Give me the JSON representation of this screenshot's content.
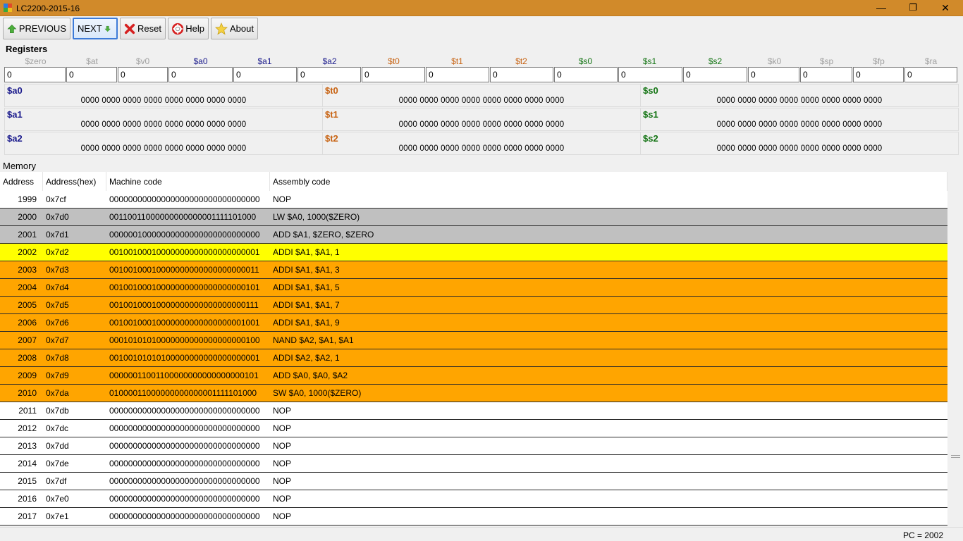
{
  "window": {
    "title": "LC2200-2015-16",
    "minimize": "—",
    "restore": "❐",
    "close": "✕"
  },
  "toolbar": {
    "previous_label": "PREVIOUS",
    "next_label": "NEXT",
    "reset_label": "Reset",
    "help_label": "Help",
    "about_label": "About"
  },
  "registers": {
    "title": "Registers",
    "names": [
      {
        "name": "$zero",
        "color": "#a0a0a0"
      },
      {
        "name": "$at",
        "color": "#a0a0a0"
      },
      {
        "name": "$v0",
        "color": "#a0a0a0"
      },
      {
        "name": "$a0",
        "color": "#1a1a8c"
      },
      {
        "name": "$a1",
        "color": "#1a1a8c"
      },
      {
        "name": "$a2",
        "color": "#1a1a8c"
      },
      {
        "name": "$t0",
        "color": "#c86414"
      },
      {
        "name": "$t1",
        "color": "#c86414"
      },
      {
        "name": "$t2",
        "color": "#c86414"
      },
      {
        "name": "$s0",
        "color": "#127312"
      },
      {
        "name": "$s1",
        "color": "#127312"
      },
      {
        "name": "$s2",
        "color": "#127312"
      },
      {
        "name": "$k0",
        "color": "#a0a0a0"
      },
      {
        "name": "$sp",
        "color": "#a0a0a0"
      },
      {
        "name": "$fp",
        "color": "#a0a0a0"
      },
      {
        "name": "$ra",
        "color": "#a0a0a0"
      }
    ],
    "values": [
      "0",
      "0",
      "0",
      "0",
      "0",
      "0",
      "0",
      "0",
      "0",
      "0",
      "0",
      "0",
      "0",
      "0",
      "0",
      "0"
    ],
    "binary": [
      {
        "name": "$a0",
        "value": "0000 0000 0000 0000 0000 0000 0000 0000",
        "color": "#1a1a8c"
      },
      {
        "name": "$t0",
        "value": "0000 0000 0000 0000 0000 0000 0000 0000",
        "color": "#c86414"
      },
      {
        "name": "$s0",
        "value": "0000 0000 0000 0000 0000 0000 0000 0000",
        "color": "#127312"
      },
      {
        "name": "$a1",
        "value": "0000 0000 0000 0000 0000 0000 0000 0000",
        "color": "#1a1a8c"
      },
      {
        "name": "$t1",
        "value": "0000 0000 0000 0000 0000 0000 0000 0000",
        "color": "#c86414"
      },
      {
        "name": "$s1",
        "value": "0000 0000 0000 0000 0000 0000 0000 0000",
        "color": "#127312"
      },
      {
        "name": "$a2",
        "value": "0000 0000 0000 0000 0000 0000 0000 0000",
        "color": "#1a1a8c"
      },
      {
        "name": "$t2",
        "value": "0000 0000 0000 0000 0000 0000 0000 0000",
        "color": "#c86414"
      },
      {
        "name": "$s2",
        "value": "0000 0000 0000 0000 0000 0000 0000 0000",
        "color": "#127312"
      }
    ]
  },
  "memory": {
    "title": "Memory",
    "columns": [
      "Address",
      "Address(hex)",
      "Machine code",
      "Assembly code"
    ],
    "rows": [
      {
        "addr": "1999",
        "hex": "0x7cf",
        "code": "00000000000000000000000000000000",
        "asm": "NOP",
        "bg": "#ffffff"
      },
      {
        "addr": "2000",
        "hex": "0x7d0",
        "code": "00110011000000000000001111101000",
        "asm": "LW $A0, 1000($ZERO)",
        "bg": "#c0c0c0"
      },
      {
        "addr": "2001",
        "hex": "0x7d1",
        "code": "00000010000000000000000000000000",
        "asm": "ADD $A1, $ZERO, $ZERO",
        "bg": "#c0c0c0"
      },
      {
        "addr": "2002",
        "hex": "0x7d2",
        "code": "00100100010000000000000000000001",
        "asm": "ADDI $A1, $A1, 1",
        "bg": "#ffff00"
      },
      {
        "addr": "2003",
        "hex": "0x7d3",
        "code": "00100100010000000000000000000011",
        "asm": "ADDI $A1, $A1, 3",
        "bg": "#ffa500"
      },
      {
        "addr": "2004",
        "hex": "0x7d4",
        "code": "00100100010000000000000000000101",
        "asm": "ADDI $A1, $A1, 5",
        "bg": "#ffa500"
      },
      {
        "addr": "2005",
        "hex": "0x7d5",
        "code": "00100100010000000000000000000111",
        "asm": "ADDI $A1, $A1, 7",
        "bg": "#ffa500"
      },
      {
        "addr": "2006",
        "hex": "0x7d6",
        "code": "00100100010000000000000000001001",
        "asm": "ADDI $A1, $A1, 9",
        "bg": "#ffa500"
      },
      {
        "addr": "2007",
        "hex": "0x7d7",
        "code": "00010101010000000000000000000100",
        "asm": "NAND $A2, $A1, $A1",
        "bg": "#ffa500"
      },
      {
        "addr": "2008",
        "hex": "0x7d8",
        "code": "00100101010100000000000000000001",
        "asm": "ADDI $A2, $A2, 1",
        "bg": "#ffa500"
      },
      {
        "addr": "2009",
        "hex": "0x7d9",
        "code": "00000011001100000000000000000101",
        "asm": "ADD $A0, $A0, $A2",
        "bg": "#ffa500"
      },
      {
        "addr": "2010",
        "hex": "0x7da",
        "code": "01000011000000000000001111101000",
        "asm": "SW $A0, 1000($ZERO)",
        "bg": "#ffa500"
      },
      {
        "addr": "2011",
        "hex": "0x7db",
        "code": "00000000000000000000000000000000",
        "asm": "NOP",
        "bg": "#ffffff"
      },
      {
        "addr": "2012",
        "hex": "0x7dc",
        "code": "00000000000000000000000000000000",
        "asm": "NOP",
        "bg": "#ffffff"
      },
      {
        "addr": "2013",
        "hex": "0x7dd",
        "code": "00000000000000000000000000000000",
        "asm": "NOP",
        "bg": "#ffffff"
      },
      {
        "addr": "2014",
        "hex": "0x7de",
        "code": "00000000000000000000000000000000",
        "asm": "NOP",
        "bg": "#ffffff"
      },
      {
        "addr": "2015",
        "hex": "0x7df",
        "code": "00000000000000000000000000000000",
        "asm": "NOP",
        "bg": "#ffffff"
      },
      {
        "addr": "2016",
        "hex": "0x7e0",
        "code": "00000000000000000000000000000000",
        "asm": "NOP",
        "bg": "#ffffff"
      },
      {
        "addr": "2017",
        "hex": "0x7e1",
        "code": "00000000000000000000000000000000",
        "asm": "NOP",
        "bg": "#ffffff"
      }
    ]
  },
  "status": {
    "pc": "PC = 2002"
  }
}
